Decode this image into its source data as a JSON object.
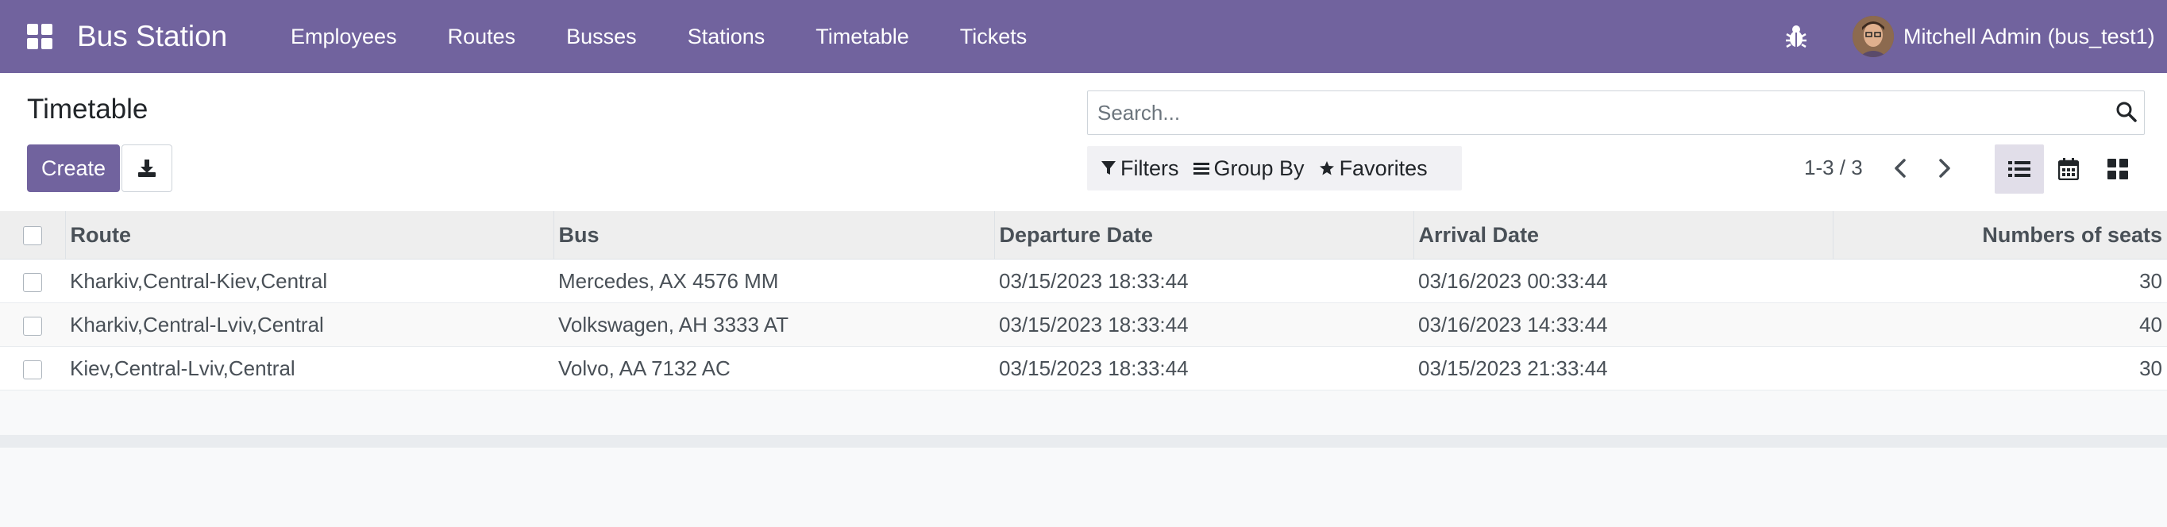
{
  "navbar": {
    "app_name": "Bus Station",
    "menu": [
      "Employees",
      "Routes",
      "Busses",
      "Stations",
      "Timetable",
      "Tickets"
    ],
    "user_name": "Mitchell Admin (bus_test1)",
    "accent_color": "#71639e"
  },
  "control_panel": {
    "title": "Timetable",
    "create_label": "Create",
    "search_placeholder": "Search...",
    "filters_label": "Filters",
    "group_by_label": "Group By",
    "favorites_label": "Favorites",
    "pager": "1-3 / 3",
    "views": [
      "list-view",
      "calendar-view",
      "kanban-view"
    ],
    "active_view": "list-view"
  },
  "table": {
    "columns": [
      "Route",
      "Bus",
      "Departure Date",
      "Arrival Date",
      "Numbers of seats"
    ],
    "rows": [
      [
        "Kharkiv,Central-Kiev,Central",
        "Mercedes, AX 4576 MM",
        "03/15/2023 18:33:44",
        "03/16/2023 00:33:44",
        "30"
      ],
      [
        "Kharkiv,Central-Lviv,Central",
        "Volkswagen, AH 3333 AT",
        "03/15/2023 18:33:44",
        "03/16/2023 14:33:44",
        "40"
      ],
      [
        "Kiev,Central-Lviv,Central",
        "Volvo, AA 7132 AC",
        "03/15/2023 18:33:44",
        "03/15/2023 21:33:44",
        "30"
      ]
    ]
  }
}
